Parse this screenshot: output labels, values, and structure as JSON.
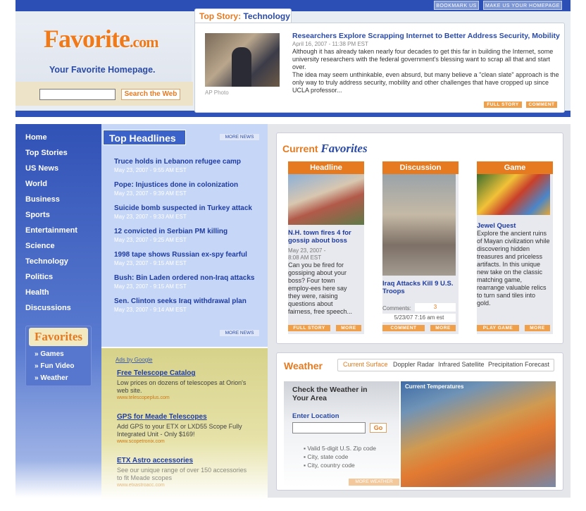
{
  "top": {
    "bookmark": "BOOKMARK US",
    "homepage": "MAKE US YOUR HOMEPAGE"
  },
  "brand": {
    "logo": "Favorite",
    "logo_suffix": ".com",
    "tagline": "Your Favorite Homepage."
  },
  "search": {
    "button": "Search the Web",
    "value": ""
  },
  "top_story": {
    "tab_a": "Top Story:",
    "tab_b": "Technology",
    "photo_credit": "AP Photo",
    "title": "Researchers Explore Scrapping Internet to Better Address Security, Mobility",
    "date": "April 16, 2007 - 11:38 PM EST",
    "p1": "Although it has already taken nearly four decades to get this far in building the Internet, some university researchers with the federal government's blessing want to scrap all that and start over.",
    "p2": "The idea may seem unthinkable, even absurd, but many believe a \"clean slate\" approach is the only way to truly address security, mobility and other challenges that have cropped up since UCLA professor...",
    "full_story": "FULL STORY",
    "comment": "COMMENT"
  },
  "nav": [
    "Home",
    "Top Stories",
    "US News",
    "World",
    "Business",
    "Sports",
    "Entertainment",
    "Science",
    "Technology",
    "Politics",
    "Health",
    "Discussions"
  ],
  "favorites": {
    "logo": "Favorites",
    "items": [
      "Games",
      "Fun Video",
      "Weather"
    ]
  },
  "headlines": {
    "title": "Top Headlines",
    "more": "MORE NEWS",
    "items": [
      {
        "t": "Truce holds in Lebanon refugee camp",
        "d": "May 23, 2007 - 9:55 AM EST"
      },
      {
        "t": "Pope: Injustices done in colonization",
        "d": "May 23, 2007 - 9:39 AM EST"
      },
      {
        "t": "Suicide bomb suspected in Turkey attack",
        "d": "May 23, 2007 - 9:33 AM EST"
      },
      {
        "t": "12 convicted in Serbian PM killing",
        "d": "May 23, 2007 - 9:25 AM EST"
      },
      {
        "t": "1998 tape shows Russian ex-spy fearful",
        "d": "May 23, 2007 - 9:15 AM EST"
      },
      {
        "t": "Bush: Bin Laden ordered non-Iraq attacks",
        "d": "May 23, 2007 - 9:15 AM EST"
      },
      {
        "t": "Sen. Clinton seeks Iraq withdrawal plan",
        "d": "May 23, 2007 - 9:14 AM EST"
      }
    ]
  },
  "ads": {
    "by": "Ads by Google",
    "items": [
      {
        "t": "Free Telescope Catalog",
        "b": "Low prices on dozens of telescopes at Orion's web site.",
        "u": "www.telescopeplus.com"
      },
      {
        "t": "GPS for Meade Telescopes",
        "b": "Add GPS to your ETX or LXD55 Scope Fully Integrated Unit - Only $169!",
        "u": "www.scopetronix.com"
      },
      {
        "t": "ETX Astro accessories",
        "b": "See our unique range of over 150 accessories to fit Meade scopes",
        "u": "www.etxastroacc.com"
      }
    ]
  },
  "current": {
    "title_a": "Current",
    "title_b": "Favorites",
    "headline": {
      "head": "Headline",
      "title": "N.H. town fires 4 for gossip about boss",
      "date": "May 23, 2007 -",
      "time": "8:08 AM EST",
      "text": "Can you be fired for gossiping about your boss? Four town employ-ees here say they were, raising questions about fairness, free speech...",
      "b1": "FULL STORY",
      "b2": "MORE"
    },
    "discussion": {
      "head": "Discussion",
      "title": "Iraq Attacks Kill 9 U.S. Troops",
      "comments_label": "Comments:",
      "comments": "3",
      "stamp": "5/23/07 7:16 am est",
      "b1": "COMMENT",
      "b2": "MORE"
    },
    "game": {
      "head": "Game",
      "title": "Jewel Quest",
      "text": "Explore the ancient ruins of Mayan civilization while discovering hidden treasures and priceless artifacts. In this unique new take on the classic matching game, rearrange valuable relics to turn sand tiles into gold.",
      "b1": "PLAY GAME",
      "b2": "MORE"
    }
  },
  "weather": {
    "title": "Weather",
    "tabs": [
      "Current Surface",
      "Doppler Radar",
      "Infrared Satellite",
      "Precipitation Forecast"
    ],
    "check": "Check the Weather in Your Area",
    "enter": "Enter Location",
    "go": "Go",
    "hints": [
      "Valid 5-digit U.S. Zip code",
      "City, state code",
      "City, country code"
    ],
    "map_label": "Current Temperatures",
    "more": "MORE WEATHER"
  }
}
